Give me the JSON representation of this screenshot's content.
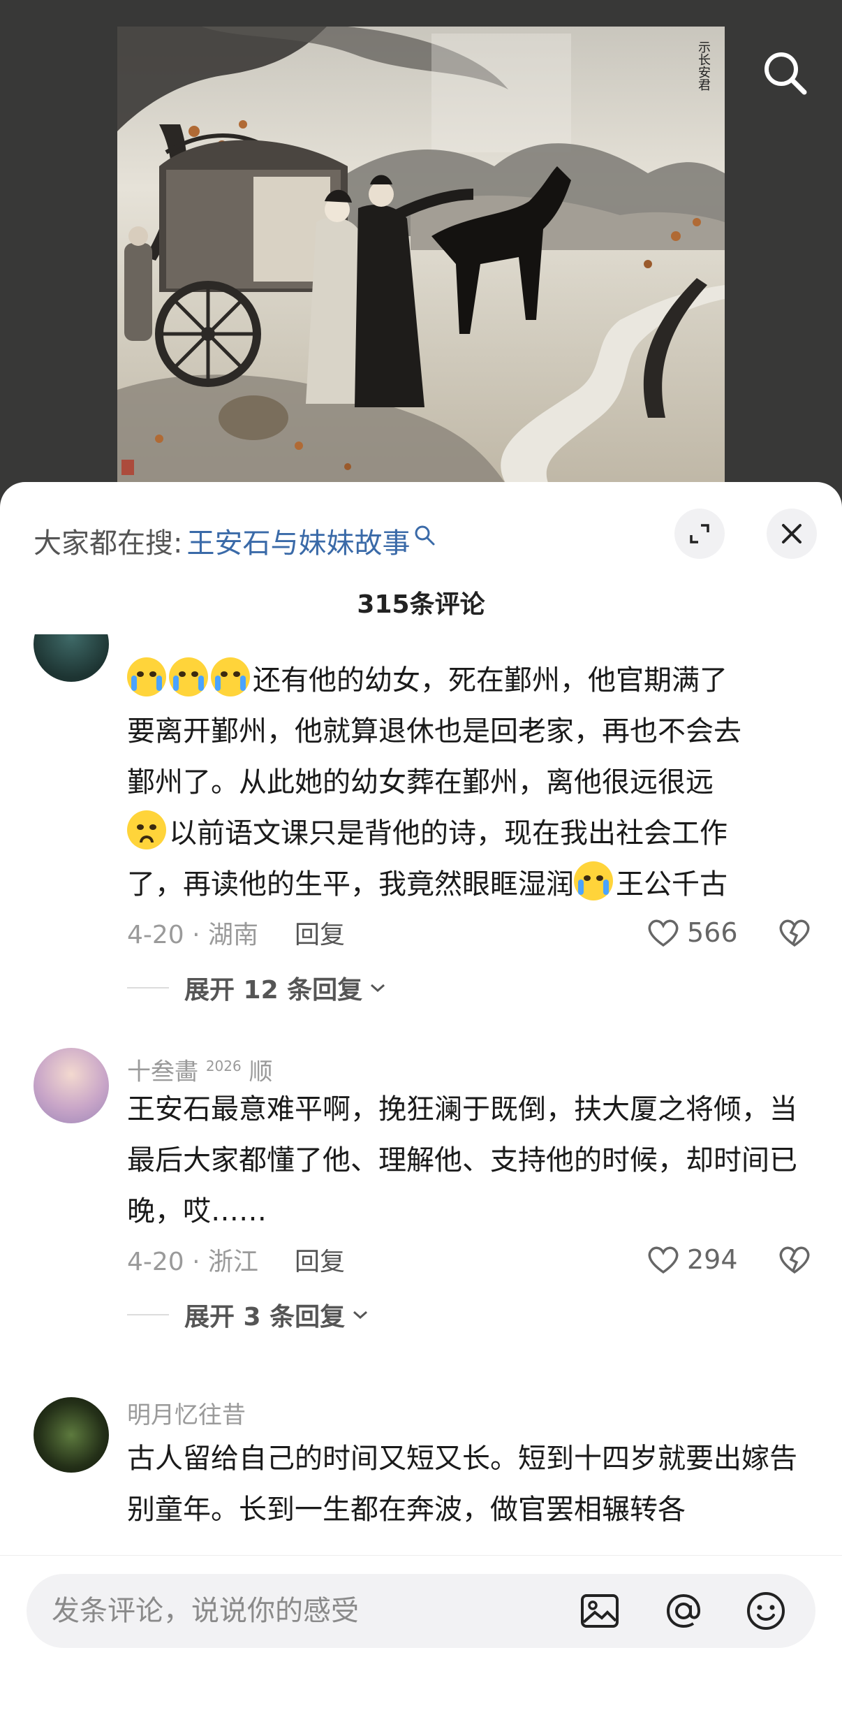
{
  "search": {
    "prefix": "大家都在搜:",
    "term": "王安石与妹妹故事"
  },
  "painting": {
    "inscription": "示长安君"
  },
  "comment_count": "315条评论",
  "comments": [
    {
      "name": "",
      "text_lines": [
        "还有他的幼女，死在鄞州，他官期满了",
        "要离开鄞州，他就算退休也是回老家，再也不会去",
        "鄞州了。从此她的幼女葬在鄞州，离他很远很远",
        "以前语文课只是背他的诗，现在我出社会工作",
        "了，再读他的生平，我竟然眼眶湿润",
        "王公千古"
      ],
      "date_loc": "4-20 · 湖南",
      "reply": "回复",
      "likes": "566",
      "expand": "展开 12 条回复"
    },
    {
      "name": "十叁畵",
      "name_sup": "2026",
      "name_suffix": "顺",
      "text": "王安石最意难平啊，挽狂澜于既倒，扶大厦之将倾，当最后大家都懂了他、理解他、支持他的时候，却时间已晚，哎……",
      "date_loc": "4-20 · 浙江",
      "reply": "回复",
      "likes": "294",
      "expand": "展开 3 条回复"
    },
    {
      "name": "明月忆往昔",
      "text": "古人留给自己的时间又短又长。短到十四岁就要出嫁告别童年。长到一生都在奔波，做官罢相辗转各"
    }
  ],
  "input": {
    "placeholder": "发条评论，说说你的感受"
  },
  "icons": {
    "search": "search-icon",
    "expand": "expand-icon",
    "close": "close-icon",
    "heart": "heart-icon",
    "broken_heart": "broken-heart-icon",
    "image": "image-icon",
    "at": "at-icon",
    "emoji": "emoji-icon"
  },
  "colors": {
    "link_blue": "#3a6aa8",
    "emoji_yellow": "#ffd43a"
  }
}
